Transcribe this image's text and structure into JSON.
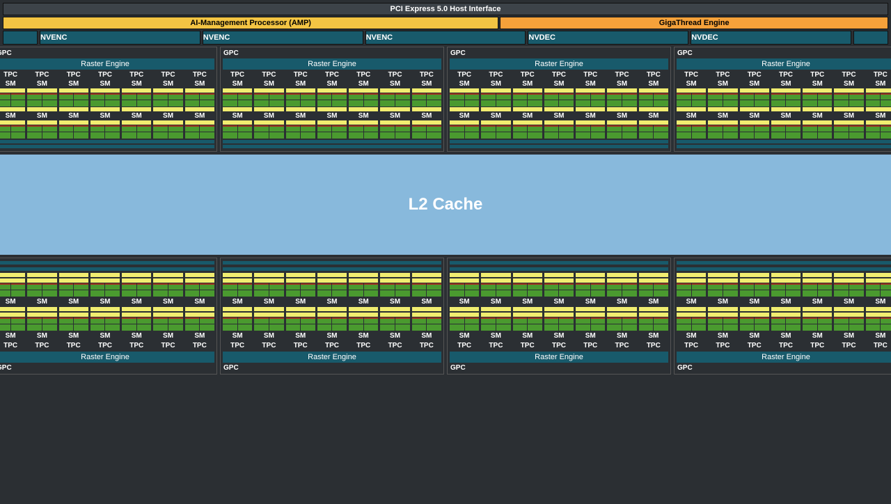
{
  "pci": "PCI Express 5.0 Host Interface",
  "amp": "AI-Management Processor (AMP)",
  "gte": "GigaThread Engine",
  "encoders": [
    "NVENC",
    "NVENC",
    "NVENC",
    "NVDEC",
    "NVDEC"
  ],
  "gpc_label": "GPC",
  "raster": "Raster Engine",
  "tpc": "TPC",
  "sm": "SM",
  "l2": "L2 Cache",
  "columns_per_gpc": 7,
  "gpc_count_top": 4,
  "gpc_count_bottom": 4,
  "colors": {
    "bg": "#2b2f33",
    "teal": "#185a6b",
    "amp": "#f3c443",
    "gte": "#f5a13a",
    "yellow": "#f1ed70",
    "green": "#4a9a2f",
    "red": "#a03020",
    "l2": "#88b9dc"
  }
}
